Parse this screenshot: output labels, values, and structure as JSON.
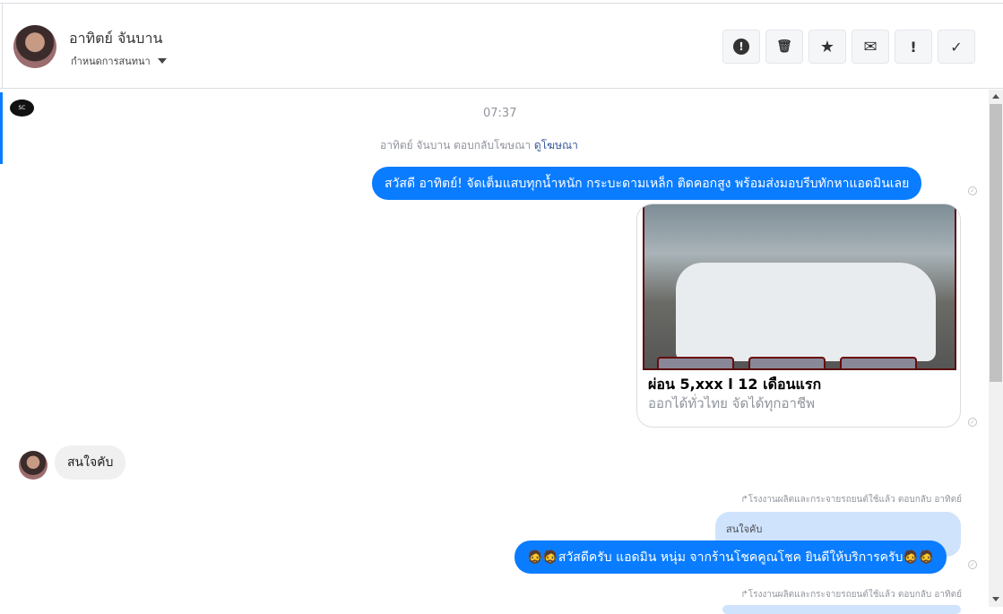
{
  "header": {
    "contact_name": "อาทิตย์ จันบาน",
    "conversation_settings": "กำหนดการสนทนา",
    "actions": [
      {
        "name": "spam",
        "glyph": "!"
      },
      {
        "name": "delete",
        "glyph": "🗑"
      },
      {
        "name": "star",
        "glyph": "★"
      },
      {
        "name": "mark-unread",
        "glyph": "✉"
      },
      {
        "name": "follow-up",
        "glyph": "!"
      },
      {
        "name": "done",
        "glyph": "✓"
      }
    ]
  },
  "page_logo_text": "SC",
  "conversation": {
    "time": "07:37",
    "reply_info": "อาทิตย์ จันบาน ตอบกลับโฆษณา",
    "view_ad_link": "ดูโฆษณา",
    "msg1": "สวัสดี อาทิตย์! จัดเต็มแสบทุกน้ำหนัก กระบะดามเหล็ก ติดคอกสูง พร้อมส่งมอบรีบทักหาแอดมินเลย",
    "card": {
      "title": "ผ่อน 5,xxx l 12 เดือนแรก",
      "description": "ออกได้ทั่วไทย จัดได้ทุกอาชีพ"
    },
    "incoming1": "สนใจคับ",
    "sender_label1": "โรงงานผลิตและกระจายรถยนต์ใช้แล้ว ตอบกลับ อาทิตย์",
    "quoted": "สนใจคับ",
    "msg2": "🧔🧔สวัสดีครับ แอดมิน หนุ่ม จากร้านโชคคูณโชค ยินดีให้บริการครับ🧔🧔",
    "sender_label2": "โรงงานผลิตและกระจายรถยนต์ใช้แล้ว ตอบกลับ อาทิตย์"
  },
  "colors": {
    "accent": "#0a7cff",
    "quote_bg": "#cfe3fc"
  }
}
